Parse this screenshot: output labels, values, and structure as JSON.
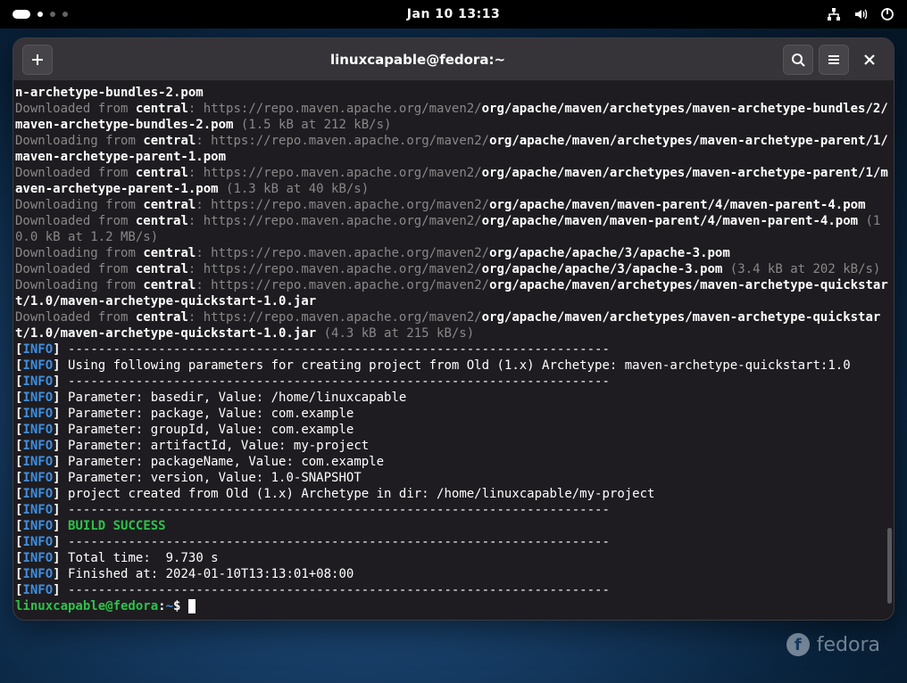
{
  "topbar": {
    "clock": "Jan 10  13:13"
  },
  "window": {
    "title": "linuxcapable@fedora:~"
  },
  "terminal": {
    "repo_name": "central",
    "repo_url": "https://repo.maven.apache.org/maven2/",
    "downloading": "Downloading",
    "downloaded": "Downloaded",
    "from": "from",
    "lines": [
      {
        "type": "frag-bold",
        "text": "n-archetype-bundles-2.pom"
      },
      {
        "type": "dl-done",
        "path": "org/apache/maven/archetypes/maven-archetype-bundles/2/maven-archetype-bundles-2.pom",
        "stats": "(1.5 kB at 212 kB/s)"
      },
      {
        "type": "dl-start",
        "path": "org/apache/maven/archetypes/maven-archetype-parent/1/maven-archetype-parent-1.pom"
      },
      {
        "type": "dl-done",
        "path": "org/apache/maven/archetypes/maven-archetype-parent/1/maven-archetype-parent-1.pom",
        "stats": "(1.3 kB at 40 kB/s)"
      },
      {
        "type": "dl-start",
        "path": "org/apache/maven/maven-parent/4/maven-parent-4.pom"
      },
      {
        "type": "dl-done",
        "path": "org/apache/maven/maven-parent/4/maven-parent-4.pom",
        "stats": "(10.0 kB at 1.2 MB/s)"
      },
      {
        "type": "dl-start",
        "path": "org/apache/apache/3/apache-3.pom"
      },
      {
        "type": "dl-done",
        "path": "org/apache/apache/3/apache-3.pom",
        "stats": "(3.4 kB at 202 kB/s)"
      },
      {
        "type": "dl-start",
        "path": "org/apache/maven/archetypes/maven-archetype-quickstart/1.0/maven-archetype-quickstart-1.0.jar"
      },
      {
        "type": "dl-done",
        "path": "org/apache/maven/archetypes/maven-archetype-quickstart/1.0/maven-archetype-quickstart-1.0.jar",
        "stats": "(4.3 kB at 215 kB/s)"
      }
    ],
    "info_lines": [
      "------------------------------------------------------------------------",
      "Using following parameters for creating project from Old (1.x) Archetype: maven-archetype-quickstart:1.0",
      "------------------------------------------------------------------------",
      "Parameter: basedir, Value: /home/linuxcapable",
      "Parameter: package, Value: com.example",
      "Parameter: groupId, Value: com.example",
      "Parameter: artifactId, Value: my-project",
      "Parameter: packageName, Value: com.example",
      "Parameter: version, Value: 1.0-SNAPSHOT",
      "project created from Old (1.x) Archetype in dir: /home/linuxcapable/my-project",
      "------------------------------------------------------------------------"
    ],
    "build_success": "BUILD SUCCESS",
    "tail_lines": [
      "------------------------------------------------------------------------",
      "Total time:  9.730 s",
      "Finished at: 2024-01-10T13:13:01+08:00",
      "------------------------------------------------------------------------"
    ],
    "prompt_user": "linuxcapable@fedora",
    "prompt_path": "~",
    "prompt_symbol": "$"
  },
  "watermark": {
    "text": "fedora"
  }
}
